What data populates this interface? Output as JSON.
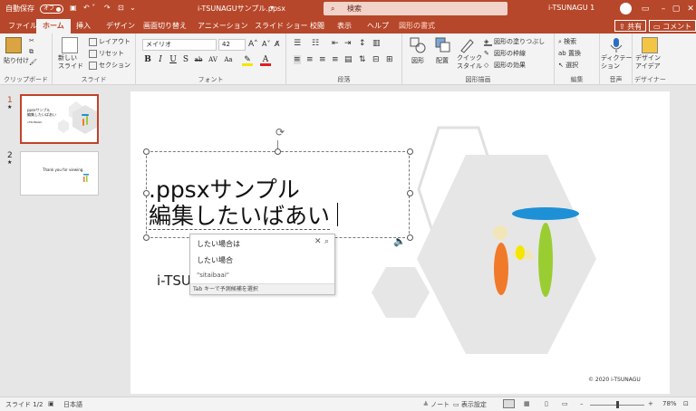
{
  "titlebar": {
    "autosave_label": "自動保存",
    "autosave_state": "オフ",
    "filename": "i-TSUNAGUサンプル.ppsx",
    "search_placeholder": "検索",
    "user": "i-TSUNAGU 1"
  },
  "tabs": [
    "ファイル",
    "ホーム",
    "挿入",
    "デザイン",
    "画面切り替え",
    "アニメーション",
    "スライド ショー",
    "校閲",
    "表示",
    "ヘルプ",
    "図形の書式"
  ],
  "header_buttons": {
    "share": "共有",
    "comments": "コメント"
  },
  "ribbon": {
    "clipboard": {
      "paste": "貼り付け",
      "label": "クリップボード"
    },
    "slides": {
      "new": "新しい\nスライド",
      "layout": "レイアウト",
      "reset": "リセット",
      "section": "セクション",
      "label": "スライド"
    },
    "font": {
      "name": "メイリオ",
      "size": "42",
      "label": "フォント",
      "buttons": [
        "B",
        "I",
        "U",
        "S",
        "ab",
        "AV",
        "Aa"
      ]
    },
    "paragraph": {
      "label": "段落"
    },
    "drawing": {
      "shape": "図形",
      "arrange": "配置",
      "quick": "クイック\nスタイル",
      "fill": "図形の塗りつぶし",
      "outline": "図形の枠線",
      "effects": "図形の効果",
      "label": "図形描画"
    },
    "editing": {
      "find": "検索",
      "replace": "置換",
      "select": "選択",
      "label": "編集"
    },
    "voice": {
      "dictate": "ディクテー\nション",
      "label": "音声"
    },
    "designer": {
      "ideas": "デザイン\nアイデア",
      "label": "デザイナー"
    }
  },
  "thumbnails": [
    {
      "num": "1",
      "title": "ppsxサンプル",
      "sub": "編集したいばあい",
      "author": "i-TSUNAGU"
    },
    {
      "num": "2",
      "text": "Thank you for viewing."
    }
  ],
  "slide": {
    "title_line1": ".ppsxサンプル",
    "title_line2": "編集したいばあい",
    "subtitle": "i-TSU",
    "copyright": "© 2020 i-TSUNAGU"
  },
  "autocomplete": {
    "items": [
      "したい場合は",
      "したい場合",
      "\"sitaibaai\""
    ],
    "footer": "Tab キーで予測候補を選択"
  },
  "status": {
    "slide": "スライド 1/2",
    "language": "日本語",
    "notes": "ノート",
    "display": "表示設定",
    "zoom": "78%"
  }
}
